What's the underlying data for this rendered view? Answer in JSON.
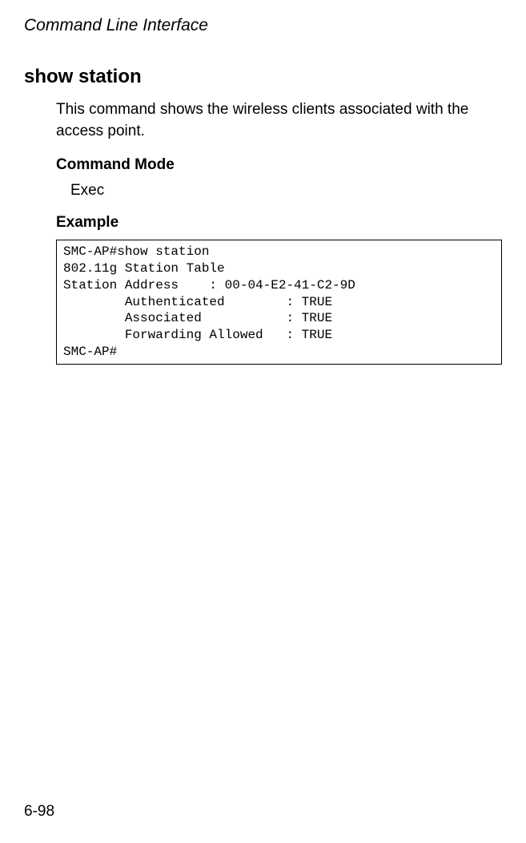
{
  "header": {
    "title": "Command Line Interface"
  },
  "command": {
    "name": "show station",
    "description": "This command shows the wireless clients associated with the access point.",
    "mode_label": "Command Mode",
    "mode_value": "Exec",
    "example_label": "Example",
    "example_output": "SMC-AP#show station\n802.11g Station Table\nStation Address    : 00-04-E2-41-C2-9D\n        Authenticated        : TRUE\n        Associated           : TRUE\n        Forwarding Allowed   : TRUE\nSMC-AP#"
  },
  "footer": {
    "page_number": "6-98"
  }
}
